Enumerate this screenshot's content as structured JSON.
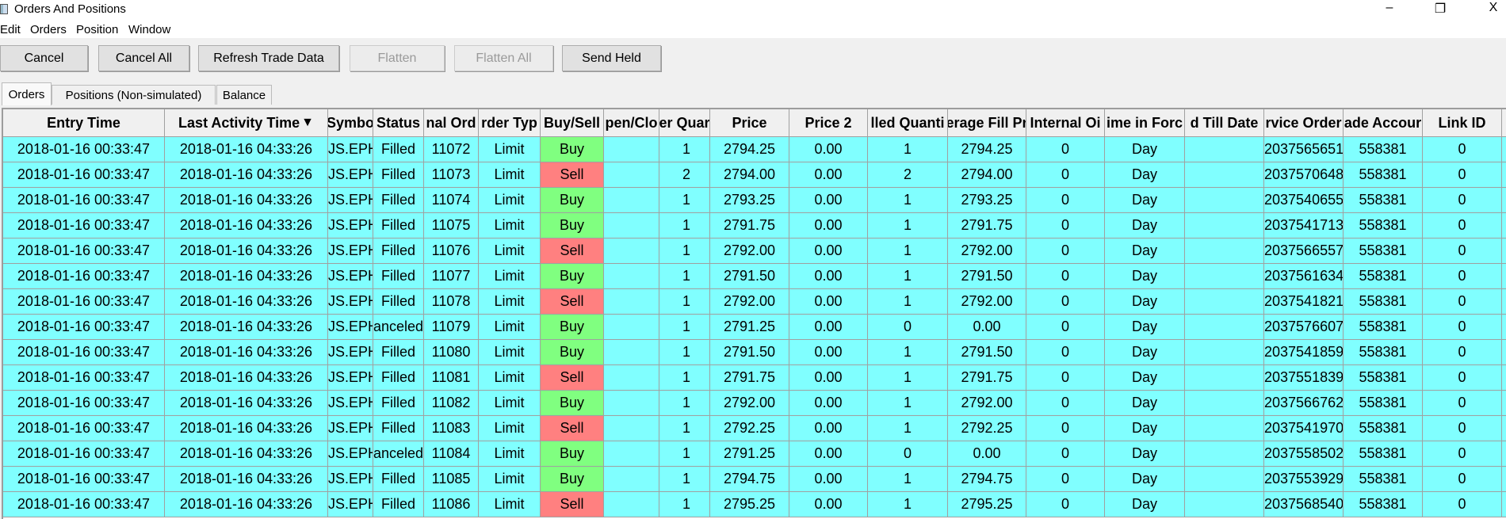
{
  "window": {
    "title": "Orders And Positions",
    "controls": [
      "–",
      "❐",
      "X"
    ]
  },
  "menu": [
    "Edit",
    "Orders",
    "Position",
    "Window"
  ],
  "toolbar": [
    {
      "label": "Cancel",
      "enabled": true
    },
    {
      "label": "Cancel All",
      "enabled": true
    },
    {
      "label": "Refresh Trade Data",
      "enabled": true
    },
    {
      "label": "Flatten",
      "enabled": false
    },
    {
      "label": "Flatten All",
      "enabled": false
    },
    {
      "label": "Send Held",
      "enabled": true
    }
  ],
  "tabs": [
    {
      "label": "Orders",
      "active": true
    },
    {
      "label": "Positions (Non-simulated)",
      "active": false
    },
    {
      "label": "Balance",
      "active": false
    }
  ],
  "colors": {
    "row": "#80ffff",
    "buy": "#80ff80",
    "sell": "#ff8080",
    "grid": "#a0a0a0"
  },
  "table": {
    "sort_column": 1,
    "sort_icon": "▼",
    "columns": [
      "Entry Time",
      "Last Activity Time",
      "Symbo",
      "Status",
      "nal Ord",
      "rder Typ",
      "Buy/Sell",
      "pen/Clo",
      "er Quar",
      "Price",
      "Price 2",
      "lled Quanti",
      "erage Fill Pr",
      "Internal Oi",
      "ime in Forc",
      "d Till Date",
      "rvice Order",
      "ade Accour",
      "Link ID"
    ],
    "rows": [
      [
        "2018-01-16  00:33:47",
        "2018-01-16  04:33:26",
        "JS.EPH",
        "Filled",
        "11072",
        "Limit",
        "Buy",
        "",
        "1",
        "2794.25",
        "0.00",
        "1",
        "2794.25",
        "0",
        "Day",
        "",
        "2037565651",
        "558381",
        "0"
      ],
      [
        "2018-01-16  00:33:47",
        "2018-01-16  04:33:26",
        "JS.EPH",
        "Filled",
        "11073",
        "Limit",
        "Sell",
        "",
        "2",
        "2794.00",
        "0.00",
        "2",
        "2794.00",
        "0",
        "Day",
        "",
        "2037570648",
        "558381",
        "0"
      ],
      [
        "2018-01-16  00:33:47",
        "2018-01-16  04:33:26",
        "JS.EPH",
        "Filled",
        "11074",
        "Limit",
        "Buy",
        "",
        "1",
        "2793.25",
        "0.00",
        "1",
        "2793.25",
        "0",
        "Day",
        "",
        "2037540655",
        "558381",
        "0"
      ],
      [
        "2018-01-16  00:33:47",
        "2018-01-16  04:33:26",
        "JS.EPH",
        "Filled",
        "11075",
        "Limit",
        "Buy",
        "",
        "1",
        "2791.75",
        "0.00",
        "1",
        "2791.75",
        "0",
        "Day",
        "",
        "2037541713",
        "558381",
        "0"
      ],
      [
        "2018-01-16  00:33:47",
        "2018-01-16  04:33:26",
        "JS.EPH",
        "Filled",
        "11076",
        "Limit",
        "Sell",
        "",
        "1",
        "2792.00",
        "0.00",
        "1",
        "2792.00",
        "0",
        "Day",
        "",
        "2037566557",
        "558381",
        "0"
      ],
      [
        "2018-01-16  00:33:47",
        "2018-01-16  04:33:26",
        "JS.EPH",
        "Filled",
        "11077",
        "Limit",
        "Buy",
        "",
        "1",
        "2791.50",
        "0.00",
        "1",
        "2791.50",
        "0",
        "Day",
        "",
        "2037561634",
        "558381",
        "0"
      ],
      [
        "2018-01-16  00:33:47",
        "2018-01-16  04:33:26",
        "JS.EPH",
        "Filled",
        "11078",
        "Limit",
        "Sell",
        "",
        "1",
        "2792.00",
        "0.00",
        "1",
        "2792.00",
        "0",
        "Day",
        "",
        "2037541821",
        "558381",
        "0"
      ],
      [
        "2018-01-16  00:33:47",
        "2018-01-16  04:33:26",
        "JS.EPH",
        "anceled",
        "11079",
        "Limit",
        "Buy",
        "",
        "1",
        "2791.25",
        "0.00",
        "0",
        "0.00",
        "0",
        "Day",
        "",
        "2037576607",
        "558381",
        "0"
      ],
      [
        "2018-01-16  00:33:47",
        "2018-01-16  04:33:26",
        "JS.EPH",
        "Filled",
        "11080",
        "Limit",
        "Buy",
        "",
        "1",
        "2791.50",
        "0.00",
        "1",
        "2791.50",
        "0",
        "Day",
        "",
        "2037541859",
        "558381",
        "0"
      ],
      [
        "2018-01-16  00:33:47",
        "2018-01-16  04:33:26",
        "JS.EPH",
        "Filled",
        "11081",
        "Limit",
        "Sell",
        "",
        "1",
        "2791.75",
        "0.00",
        "1",
        "2791.75",
        "0",
        "Day",
        "",
        "2037551839",
        "558381",
        "0"
      ],
      [
        "2018-01-16  00:33:47",
        "2018-01-16  04:33:26",
        "JS.EPH",
        "Filled",
        "11082",
        "Limit",
        "Buy",
        "",
        "1",
        "2792.00",
        "0.00",
        "1",
        "2792.00",
        "0",
        "Day",
        "",
        "2037566762",
        "558381",
        "0"
      ],
      [
        "2018-01-16  00:33:47",
        "2018-01-16  04:33:26",
        "JS.EPH",
        "Filled",
        "11083",
        "Limit",
        "Sell",
        "",
        "1",
        "2792.25",
        "0.00",
        "1",
        "2792.25",
        "0",
        "Day",
        "",
        "2037541970",
        "558381",
        "0"
      ],
      [
        "2018-01-16  00:33:47",
        "2018-01-16  04:33:26",
        "JS.EPH",
        "anceled",
        "11084",
        "Limit",
        "Buy",
        "",
        "1",
        "2791.25",
        "0.00",
        "0",
        "0.00",
        "0",
        "Day",
        "",
        "2037558502",
        "558381",
        "0"
      ],
      [
        "2018-01-16  00:33:47",
        "2018-01-16  04:33:26",
        "JS.EPH",
        "Filled",
        "11085",
        "Limit",
        "Buy",
        "",
        "1",
        "2794.75",
        "0.00",
        "1",
        "2794.75",
        "0",
        "Day",
        "",
        "2037553929",
        "558381",
        "0"
      ],
      [
        "2018-01-16  00:33:47",
        "2018-01-16  04:33:26",
        "JS.EPH",
        "Filled",
        "11086",
        "Limit",
        "Sell",
        "",
        "1",
        "2795.25",
        "0.00",
        "1",
        "2795.25",
        "0",
        "Day",
        "",
        "2037568540",
        "558381",
        "0"
      ]
    ]
  }
}
